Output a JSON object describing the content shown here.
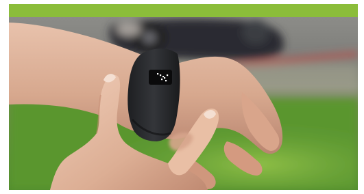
{
  "banner": {
    "color": "#8bbd3a"
  },
  "photo": {
    "subject": "wrist-fitness-tracker",
    "tracker_display": {
      "color": "#ffffff"
    }
  }
}
